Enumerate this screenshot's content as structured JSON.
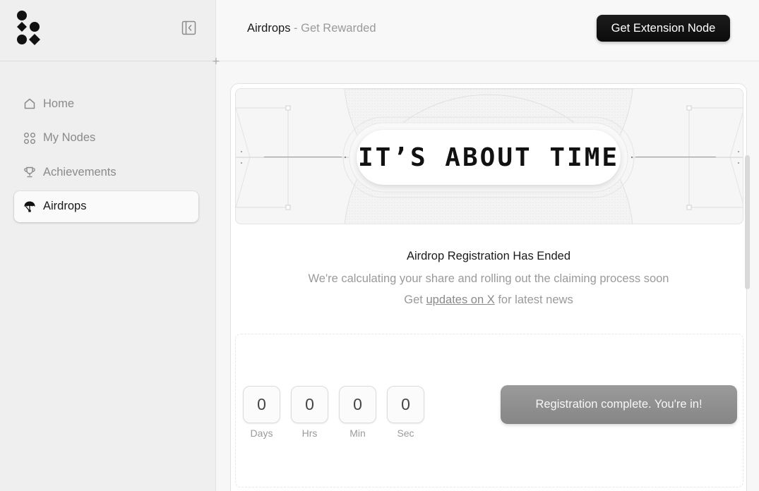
{
  "sidebar": {
    "items": [
      {
        "label": "Home",
        "icon": "home-icon",
        "active": false
      },
      {
        "label": "My Nodes",
        "icon": "nodes-icon",
        "active": false
      },
      {
        "label": "Achievements",
        "icon": "trophy-icon",
        "active": false
      },
      {
        "label": "Airdrops",
        "icon": "parachute-icon",
        "active": true
      }
    ]
  },
  "header": {
    "breadcrumb_main": "Airdrops",
    "breadcrumb_sep": " - ",
    "breadcrumb_sub": "Get Rewarded",
    "cta_label": "Get Extension Node"
  },
  "banner": {
    "headline": "IT’S ABOUT TIME"
  },
  "status": {
    "title": "Airdrop Registration Has Ended",
    "subtitle": "We're calculating your share and rolling out the claiming process soon",
    "news_prefix": "Get ",
    "news_link": "updates on X",
    "news_suffix": " for latest news"
  },
  "countdown": {
    "units": [
      {
        "value": "0",
        "label": "Days"
      },
      {
        "value": "0",
        "label": "Hrs"
      },
      {
        "value": "0",
        "label": "Min"
      },
      {
        "value": "0",
        "label": "Sec"
      }
    ],
    "button_label": "Registration complete. You're in!"
  },
  "colors": {
    "accent": "#111111",
    "muted_text": "#9a9a9a",
    "disabled_button": "#8f8f8f"
  }
}
